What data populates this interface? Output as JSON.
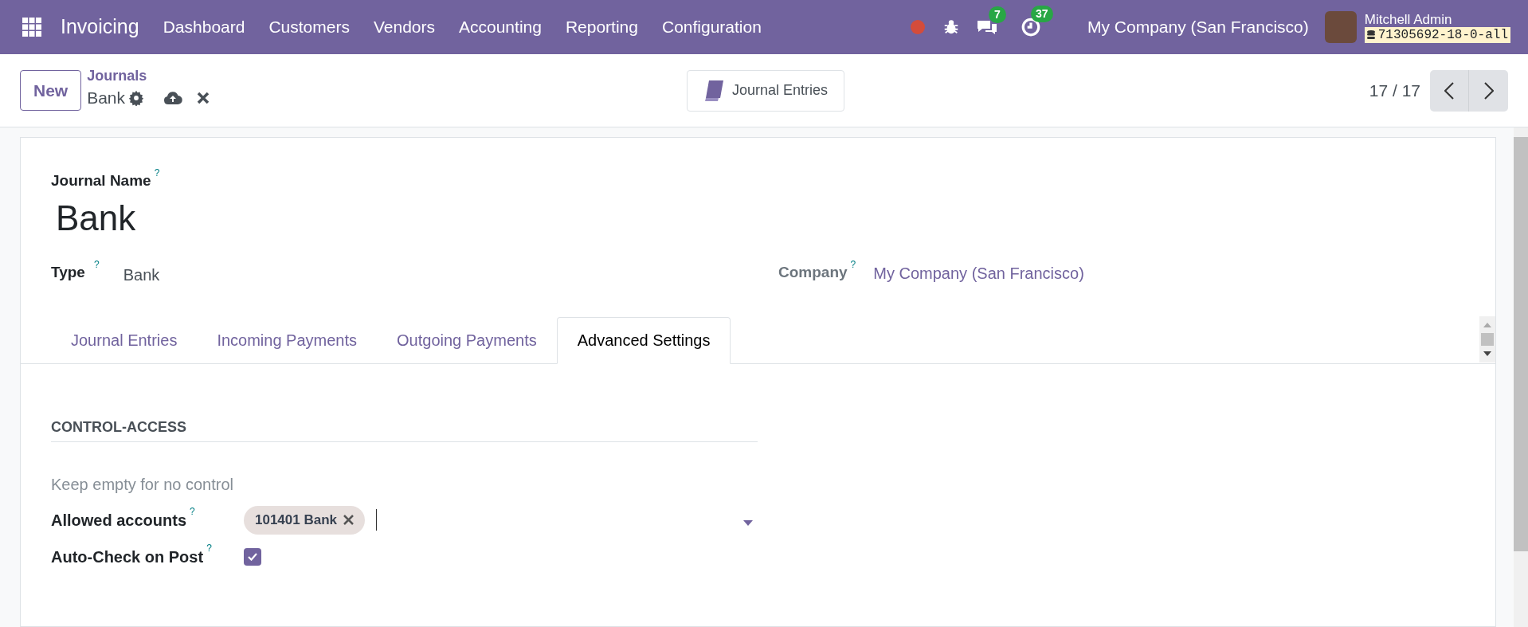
{
  "navbar": {
    "app": "Invoicing",
    "menu": [
      "Dashboard",
      "Customers",
      "Vendors",
      "Accounting",
      "Reporting",
      "Configuration"
    ],
    "messages_count": "7",
    "activities_count": "37",
    "company": "My Company (San Francisco)",
    "user": "Mitchell Admin",
    "database": "71305692-18-0-all"
  },
  "control_panel": {
    "new_button": "New",
    "breadcrumb": "Journals",
    "record": "Bank",
    "smart_button": "Journal Entries",
    "pager": "17 / 17"
  },
  "form": {
    "name_label": "Journal Name",
    "help_mark": "?",
    "name": "Bank",
    "type_label": "Type",
    "type_value": "Bank",
    "company_label": "Company",
    "company_value": "My Company (San Francisco)",
    "tabs": [
      {
        "label": "Journal Entries",
        "selected": false
      },
      {
        "label": "Incoming Payments",
        "selected": false
      },
      {
        "label": "Outgoing Payments",
        "selected": false
      },
      {
        "label": "Advanced Settings",
        "selected": true
      }
    ],
    "section_title": "CONTROL-ACCESS",
    "hint": "Keep empty for no control",
    "allowed_accounts_label": "Allowed accounts",
    "allowed_accounts": [
      "101401 Bank"
    ],
    "auto_check_label": "Auto-Check on Post",
    "auto_check": true
  }
}
